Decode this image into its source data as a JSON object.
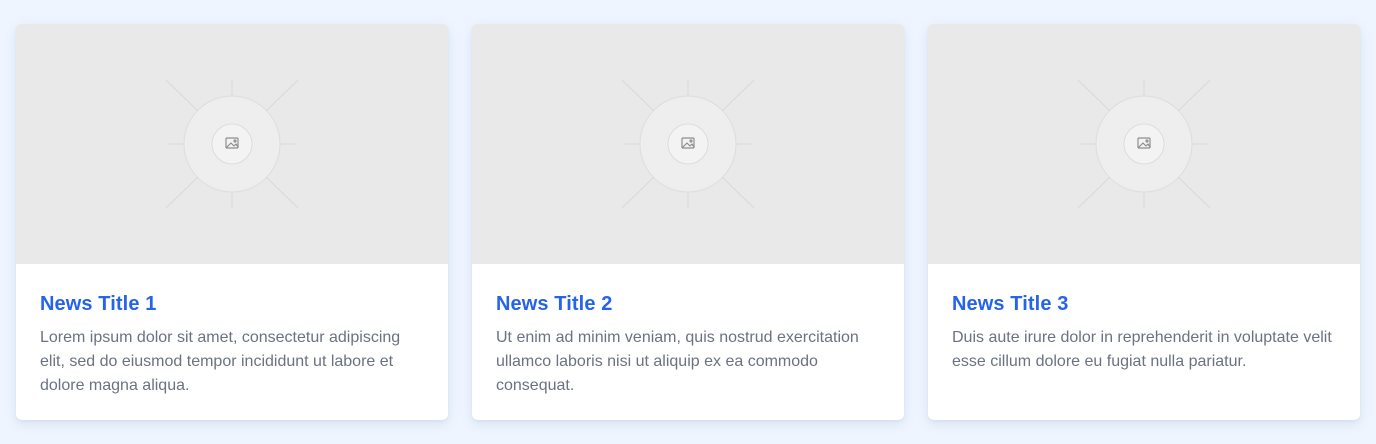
{
  "news": {
    "cards": [
      {
        "image_icon": "image-icon",
        "title": "News Title 1",
        "excerpt": "Lorem ipsum dolor sit amet, consectetur adipiscing elit, sed do eiusmod tempor incididunt ut labore et dolore magna aliqua."
      },
      {
        "image_icon": "image-icon",
        "title": "News Title 2",
        "excerpt": "Ut enim ad minim veniam, quis nostrud exercitation ullamco laboris nisi ut aliquip ex ea commodo consequat."
      },
      {
        "image_icon": "image-icon",
        "title": "News Title 3",
        "excerpt": "Duis aute irure dolor in reprehenderit in voluptate velit esse cillum dolore eu fugiat nulla pariatur."
      }
    ]
  },
  "colors": {
    "page_background": "#eef5ff",
    "card_background": "#ffffff",
    "placeholder_background": "#e9e9e9",
    "title": "#2563eb",
    "excerpt": "#6b7280"
  }
}
